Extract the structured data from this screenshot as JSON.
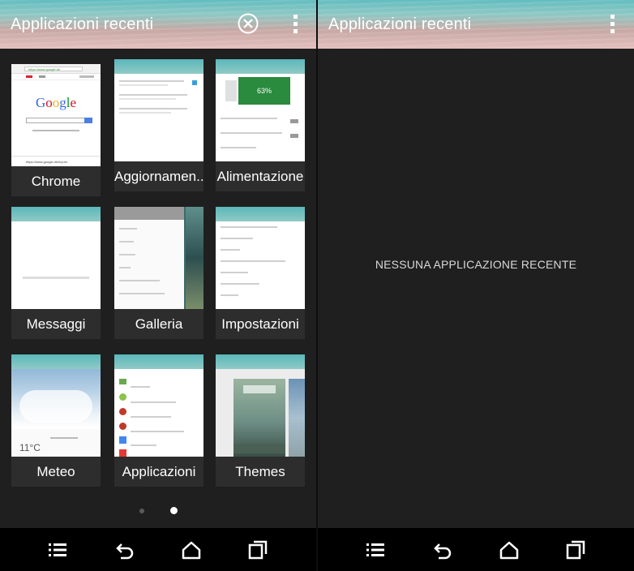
{
  "left_screen": {
    "header": {
      "title": "Applicazioni recenti",
      "close_icon": "close-circle-icon",
      "menu_icon": "overflow-menu-icon"
    },
    "apps": [
      {
        "label": "Chrome"
      },
      {
        "label": "Aggiornamen.."
      },
      {
        "label": "Alimentazione"
      },
      {
        "label": "Messaggi"
      },
      {
        "label": "Galleria"
      },
      {
        "label": "Impostazioni"
      },
      {
        "label": "Meteo"
      },
      {
        "label": "Applicazioni"
      },
      {
        "label": "Themes"
      }
    ],
    "chrome_thumb": {
      "url": "https://www.google.de",
      "logo": "Google",
      "bottom_url": "https://www.google.de/#q=ris"
    },
    "battery_thumb": {
      "percent": "63%"
    },
    "weather_thumb": {
      "temp": "11°C"
    },
    "page_indicator": {
      "total": 2,
      "active": 2
    }
  },
  "right_screen": {
    "header": {
      "title": "Applicazioni recenti",
      "menu_icon": "overflow-menu-icon"
    },
    "empty_message": "NESSUNA APPLICAZIONE RECENTE"
  },
  "nav_bar": {
    "icons": [
      "menu-icon",
      "back-icon",
      "home-icon",
      "recents-icon"
    ]
  },
  "colors": {
    "header_teal": "#63bdc0",
    "header_pink": "#e3bfbe",
    "background": "#1f1f1f",
    "label_bar": "#2d2d2d",
    "battery_green": "#2a8a3e"
  }
}
